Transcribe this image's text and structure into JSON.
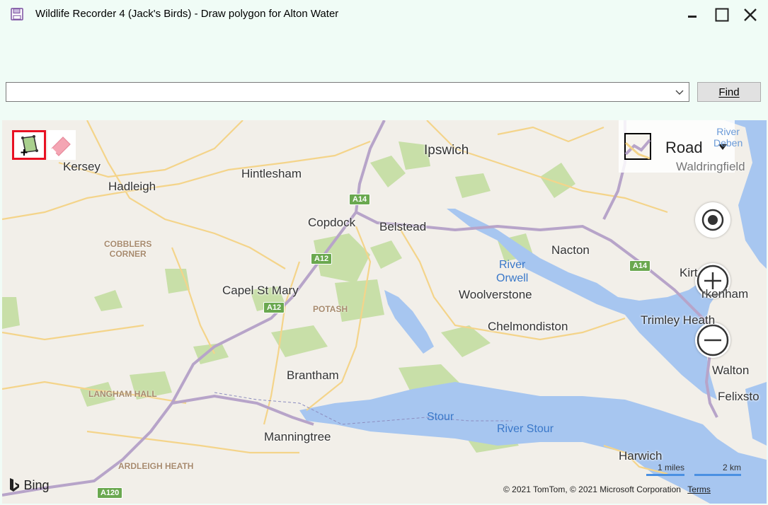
{
  "window": {
    "title": "Wildlife Recorder 4 (Jack's Birds) - Draw polygon for Alton Water",
    "icon": "save-disk-icon",
    "controls": [
      "minimize-icon",
      "maximize-icon",
      "close-icon"
    ]
  },
  "search": {
    "value": "",
    "placeholder": "",
    "find_label": "Find"
  },
  "map": {
    "provider": "Bing",
    "map_type": "Road",
    "tools": [
      "draw-polygon-icon",
      "eraser-icon"
    ],
    "towns": [
      "Kersey",
      "Hadleigh",
      "Hintlesham",
      "Ipswich",
      "Copdock",
      "Belstead",
      "Nacton",
      "Capel St Mary",
      "Woolverstone",
      "Chelmondiston",
      "Trimley Heath",
      "Brantham",
      "Manningtree",
      "Harwich",
      "Walton",
      "Felixsto",
      "Waldringfield",
      "Kirt",
      "rkenham"
    ],
    "areas": [
      "COBBLERS\nCORNER",
      "POTASH",
      "LANGHAM HALL",
      "ARDLEIGH HEATH"
    ],
    "water_labels": [
      "River\nOrwell",
      "Stour",
      "River Stour",
      "River\nDeben"
    ],
    "roads": [
      "A14",
      "A12",
      "A12",
      "A14",
      "A120"
    ],
    "scale": {
      "miles": "1 miles",
      "km": "2 km"
    },
    "copyright": "© 2021 TomTom, © 2021 Microsoft Corporation",
    "terms": "Terms",
    "colors": {
      "land": "#f2efe9",
      "water": "#a7c6f0",
      "green": "#c8dfa8",
      "major_road": "#b7a4c9",
      "minor_road": "#f4d48a",
      "accent": "#e81123"
    }
  }
}
